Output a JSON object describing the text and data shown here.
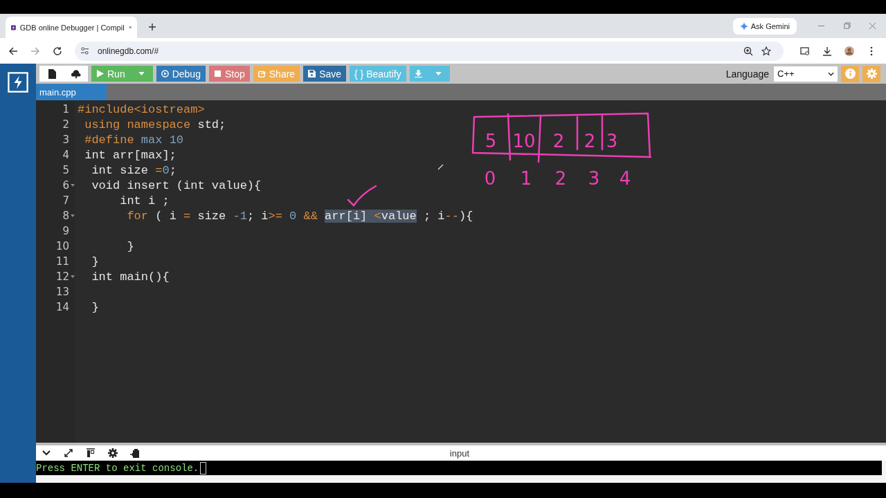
{
  "browser": {
    "tab_title": "GDB online Debugger | Compil",
    "url": "onlinegdb.com/#",
    "gemini_button": "Ask Gemini"
  },
  "toolbar": {
    "buttons": [
      {
        "kind": "run",
        "label": "Run",
        "color": "#5cb85c",
        "dropdown": true
      },
      {
        "kind": "debug",
        "label": "Debug",
        "color": "#337ab7",
        "dropdown": false
      },
      {
        "kind": "stop",
        "label": "Stop",
        "color": "#d9777a",
        "dropdown": false
      },
      {
        "kind": "share",
        "label": "Share",
        "color": "#f0ad4e",
        "dropdown": false
      },
      {
        "kind": "save",
        "label": "Save",
        "color": "#2e6da4",
        "dropdown": false
      },
      {
        "kind": "beautify",
        "label": "{ } Beautify",
        "color": "#5bc0de",
        "dropdown": false
      },
      {
        "kind": "download",
        "color": "#5bc0de",
        "dropdown": true
      }
    ],
    "language_label": "Language",
    "language": "C++"
  },
  "file_tab": "main.cpp",
  "code_lines": [
    {
      "number": "1",
      "foldable": false,
      "tokens": [
        {
          "t": "#include<iostream>",
          "kind": "keyword",
          "selected": false
        }
      ]
    },
    {
      "number": "2",
      "foldable": false,
      "tokens": [
        {
          "t": " using namespace",
          "kind": "keyword",
          "selected": false
        },
        {
          "t": " std;",
          "kind": "plain",
          "selected": false
        }
      ]
    },
    {
      "number": "3",
      "foldable": false,
      "tokens": [
        {
          "t": " #define",
          "kind": "keyword",
          "selected": false
        },
        {
          "t": " max 10",
          "kind": "number",
          "selected": false
        }
      ]
    },
    {
      "number": "4",
      "foldable": false,
      "tokens": [
        {
          "t": " int arr[max];",
          "kind": "plain",
          "selected": false
        }
      ]
    },
    {
      "number": "5",
      "foldable": false,
      "tokens": [
        {
          "t": "  int size ",
          "kind": "plain",
          "selected": false
        },
        {
          "t": "=",
          "kind": "keyword",
          "selected": false
        },
        {
          "t": "0",
          "kind": "number",
          "selected": false
        },
        {
          "t": ";",
          "kind": "plain",
          "selected": false
        }
      ]
    },
    {
      "number": "6",
      "foldable": true,
      "tokens": [
        {
          "t": "  void insert (int value){",
          "kind": "plain",
          "selected": false
        }
      ]
    },
    {
      "number": "7",
      "foldable": false,
      "tokens": [
        {
          "t": "      int i ;",
          "kind": "plain",
          "selected": false
        }
      ]
    },
    {
      "number": "8",
      "foldable": true,
      "tokens": [
        {
          "t": "       for",
          "kind": "keyword",
          "selected": false
        },
        {
          "t": " ( i ",
          "kind": "plain",
          "selected": false
        },
        {
          "t": "=",
          "kind": "keyword",
          "selected": false
        },
        {
          "t": " size ",
          "kind": "plain",
          "selected": false
        },
        {
          "t": "-1",
          "kind": "number",
          "selected": false
        },
        {
          "t": "; i",
          "kind": "plain",
          "selected": false
        },
        {
          "t": ">=",
          "kind": "keyword",
          "selected": false
        },
        {
          "t": " 0 ",
          "kind": "number",
          "selected": false
        },
        {
          "t": "&& ",
          "kind": "keyword",
          "selected": false
        },
        {
          "t": "arr[i] ",
          "kind": "plain",
          "selected": true
        },
        {
          "t": "<",
          "kind": "keyword",
          "selected": true
        },
        {
          "t": "value",
          "kind": "plain",
          "selected": true
        },
        {
          "t": " ; i",
          "kind": "plain",
          "selected": false
        },
        {
          "t": "--",
          "kind": "keyword",
          "selected": false
        },
        {
          "t": "){",
          "kind": "plain",
          "selected": false
        }
      ]
    },
    {
      "number": "9",
      "foldable": false
    },
    {
      "number": "10",
      "foldable": false,
      "tokens": [
        {
          "t": "       }",
          "kind": "plain",
          "selected": false
        }
      ]
    },
    {
      "number": "11",
      "foldable": false,
      "tokens": [
        {
          "t": "  }",
          "kind": "plain",
          "selected": false
        }
      ]
    },
    {
      "number": "12",
      "foldable": true,
      "tokens": [
        {
          "t": "  int main(){",
          "kind": "plain",
          "selected": false
        }
      ]
    },
    {
      "number": "13",
      "foldable": false
    },
    {
      "number": "14",
      "foldable": false,
      "tokens": [
        {
          "t": "  }",
          "kind": "plain",
          "selected": false
        }
      ]
    }
  ],
  "sketch": {
    "cells": [
      "5",
      "10",
      "2",
      "2",
      "3"
    ],
    "indices": [
      "0",
      "1",
      "2",
      "3",
      "4"
    ]
  },
  "console": {
    "label": "input",
    "output": "Press ENTER to exit console."
  }
}
